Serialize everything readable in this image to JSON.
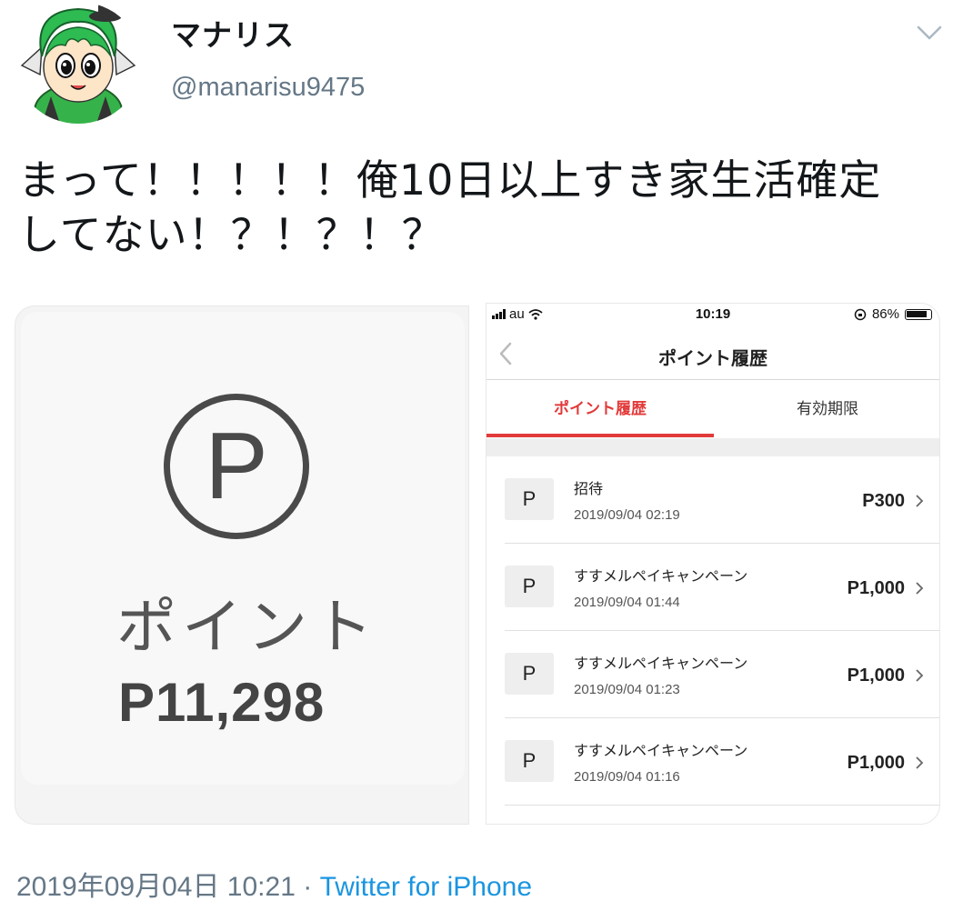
{
  "user": {
    "display_name": "マナリス",
    "handle": "@manarisu9475"
  },
  "tweet": {
    "text_line1": "まって！！！！！俺10日以上すき家生活確定",
    "text_line2": "してない！？！？！？"
  },
  "left_image": {
    "p_symbol": "P",
    "label": "ポイント",
    "value": "P11,298"
  },
  "right_image": {
    "status_bar": {
      "carrier": "au",
      "time": "10:19",
      "battery": "86%"
    },
    "nav_title": "ポイント履歴",
    "tabs": [
      {
        "label": "ポイント履歴"
      },
      {
        "label": "有効期限"
      }
    ],
    "rows": [
      {
        "icon": "P",
        "title": "招待",
        "date": "2019/09/04 02:19",
        "amount": "P300"
      },
      {
        "icon": "P",
        "title": "すすメルペイキャンペーン",
        "date": "2019/09/04 01:44",
        "amount": "P1,000"
      },
      {
        "icon": "P",
        "title": "すすメルペイキャンペーン",
        "date": "2019/09/04 01:23",
        "amount": "P1,000"
      },
      {
        "icon": "P",
        "title": "すすメルペイキャンペーン",
        "date": "2019/09/04 01:16",
        "amount": "P1,000"
      }
    ]
  },
  "footer": {
    "timestamp": "2019年09月04日 10:21",
    "separator": "·",
    "source": "Twitter for iPhone"
  }
}
